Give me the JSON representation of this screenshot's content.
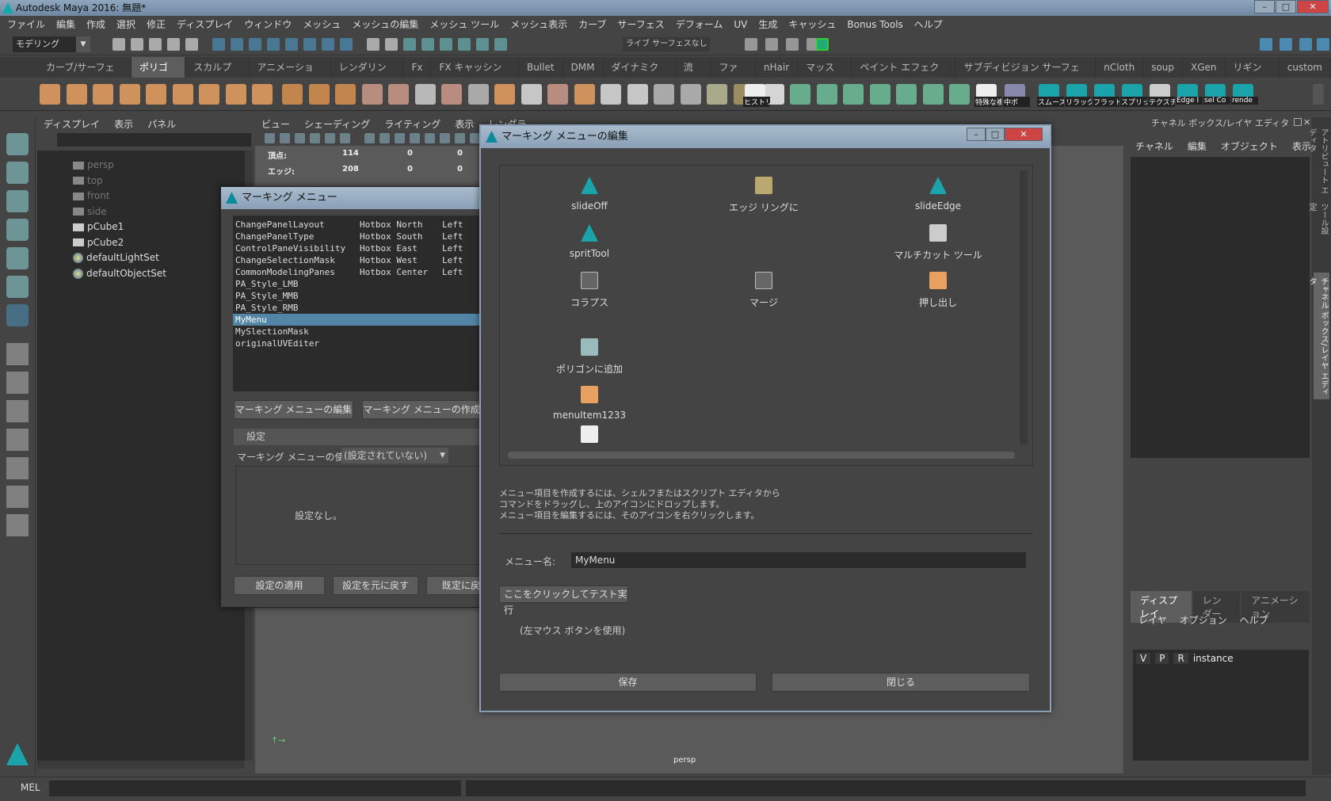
{
  "window": {
    "title": "Autodesk Maya 2016: 無題*",
    "min": "–",
    "max": "□",
    "close": "✕"
  },
  "menubar": [
    "ファイル",
    "編集",
    "作成",
    "選択",
    "修正",
    "ディスプレイ",
    "ウィンドウ",
    "メッシュ",
    "メッシュの編集",
    "メッシュ ツール",
    "メッシュ表示",
    "カーブ",
    "サーフェス",
    "デフォーム",
    "UV",
    "生成",
    "キャッシュ",
    "Bonus Tools",
    "ヘルプ"
  ],
  "statusline": {
    "mode": "モデリング",
    "live_surface": "ライブ サーフェスなし"
  },
  "shelf_tabs": [
    {
      "label": "カーブ/サーフェス"
    },
    {
      "label": "ポリゴン",
      "active": true
    },
    {
      "label": "スカルプト"
    },
    {
      "label": "アニメーション"
    },
    {
      "label": "レンダリング"
    },
    {
      "label": "Fx"
    },
    {
      "label": "FX キャッシング"
    },
    {
      "label": "Bullet"
    },
    {
      "label": "DMM"
    },
    {
      "label": "ダイナミクス"
    },
    {
      "label": "流体"
    },
    {
      "label": "ファー"
    },
    {
      "label": "nHair"
    },
    {
      "label": "マッスル"
    },
    {
      "label": "ペイント エフェクト"
    },
    {
      "label": "サブディビジョン サーフェス"
    },
    {
      "label": "nCloth"
    },
    {
      "label": "soup"
    },
    {
      "label": "XGen"
    },
    {
      "label": "リギング"
    },
    {
      "label": "custom"
    }
  ],
  "shelf_labels": [
    "ヒストリ",
    "特殊な複",
    "中ボ",
    "スムーズ",
    "リラック",
    "フラット",
    "スプリッ",
    "テクスチ",
    "Edge I",
    "sel Co",
    "rende"
  ],
  "colors": {
    "accent": "#5285a6",
    "teal": "#1aa3a8",
    "orange": "#e8a060",
    "green": "#6dbf9a"
  },
  "outliner": {
    "menu": [
      "ディスプレイ",
      "表示",
      "パネル"
    ],
    "items": [
      {
        "label": "persp",
        "type": "camera",
        "dim": true
      },
      {
        "label": "top",
        "type": "camera",
        "dim": true
      },
      {
        "label": "front",
        "type": "camera",
        "dim": true
      },
      {
        "label": "side",
        "type": "camera",
        "dim": true
      },
      {
        "label": "pCube1",
        "type": "mesh"
      },
      {
        "label": "pCube2",
        "type": "mesh"
      },
      {
        "label": "defaultLightSet",
        "type": "set"
      },
      {
        "label": "defaultObjectSet",
        "type": "set"
      }
    ]
  },
  "viewport": {
    "menu": [
      "ビュー",
      "シェーディング",
      "ライティング",
      "表示",
      "レンダラ"
    ],
    "hud": [
      {
        "label": "頂点:",
        "v": [
          "114",
          "0",
          "0"
        ]
      },
      {
        "label": "エッジ:",
        "v": [
          "208",
          "0",
          "0"
        ]
      }
    ],
    "camera": "persp"
  },
  "channelbox": {
    "title": "チャネル ボックス/レイヤ エディタ",
    "menu": [
      "チャネル",
      "編集",
      "オブジェクト",
      "表示"
    ],
    "layer_tabs": [
      "ディスプレイ",
      "レンダー",
      "アニメーション"
    ],
    "layer_menu": [
      "レイヤ",
      "オプション",
      "ヘルプ"
    ],
    "layer": {
      "v": "V",
      "p": "P",
      "r": "R",
      "name": "instance"
    }
  },
  "side_tabs": [
    "アトリビュート エディタ",
    "ツール設定",
    "チャネル ボックス/レイヤ エディタ"
  ],
  "cmdline": {
    "label": "MEL"
  },
  "marking_menu": {
    "title": "マーキング メニュー",
    "rows": [
      {
        "name": "ChangePanelLayout",
        "hotbox": "Hotbox North",
        "button": "Left"
      },
      {
        "name": "ChangePanelType",
        "hotbox": "Hotbox South",
        "button": "Left"
      },
      {
        "name": "ControlPaneVisibility",
        "hotbox": "Hotbox East",
        "button": "Left"
      },
      {
        "name": "ChangeSelectionMask",
        "hotbox": "Hotbox West",
        "button": "Left"
      },
      {
        "name": "CommonModelingPanes",
        "hotbox": "Hotbox Center",
        "button": "Left"
      },
      {
        "name": "PA_Style_LMB",
        "hotbox": "",
        "button": ""
      },
      {
        "name": "PA_Style_MMB",
        "hotbox": "",
        "button": ""
      },
      {
        "name": "PA_Style_RMB",
        "hotbox": "",
        "button": ""
      },
      {
        "name": "MyMenu",
        "hotbox": "",
        "button": "",
        "selected": true
      },
      {
        "name": "MySlectionMask",
        "hotbox": "",
        "button": ""
      },
      {
        "name": "originalUVEditer",
        "hotbox": "",
        "button": ""
      }
    ],
    "edit_btn": "マーキング メニューの編集",
    "create_btn": "マーキング メニューの作成",
    "settings_header": "設定",
    "use_label": "マーキング メニューの使用:",
    "use_value": "(設定されていない)",
    "no_settings": "設定なし。",
    "apply": "設定の適用",
    "reset": "設定を元に戻す",
    "default": "既定に戻す"
  },
  "edit_dialog": {
    "title": "マーキング メニューの編集",
    "items": [
      {
        "label": "slideOff",
        "icon": "maya-logo-icon"
      },
      {
        "label": "エッジ リングに",
        "icon": "edge-ring-icon"
      },
      {
        "label": "slideEdge",
        "icon": "maya-logo-icon"
      },
      {
        "label": "spritTool",
        "icon": "maya-logo-icon"
      },
      {
        "label": "",
        "icon": ""
      },
      {
        "label": "マルチカット ツール",
        "icon": "multicut-icon"
      },
      {
        "label": "コラプス",
        "icon": "collapse-icon"
      },
      {
        "label": "マージ",
        "icon": "merge-icon"
      },
      {
        "label": "押し出し",
        "icon": "extrude-icon"
      },
      {
        "label": "ポリゴンに追加",
        "icon": "append-polygon-icon"
      },
      {
        "label": "menuItem1233",
        "icon": "cube-icon"
      },
      {
        "label": "",
        "icon": "script-edit-icon"
      }
    ],
    "help": [
      "メニュー項目を作成するには、シェルフまたはスクリプト エディタから",
      "コマンドをドラッグし、上のアイコンにドロップします。",
      "メニュー項目を編集するには、そのアイコンを右クリックします。"
    ],
    "menu_name_label": "メニュー名:",
    "menu_name_value": "MyMenu",
    "test_btn": "ここをクリックしてテスト実行",
    "test_hint": "(左マウス ボタンを使用)",
    "save": "保存",
    "close": "閉じる"
  }
}
